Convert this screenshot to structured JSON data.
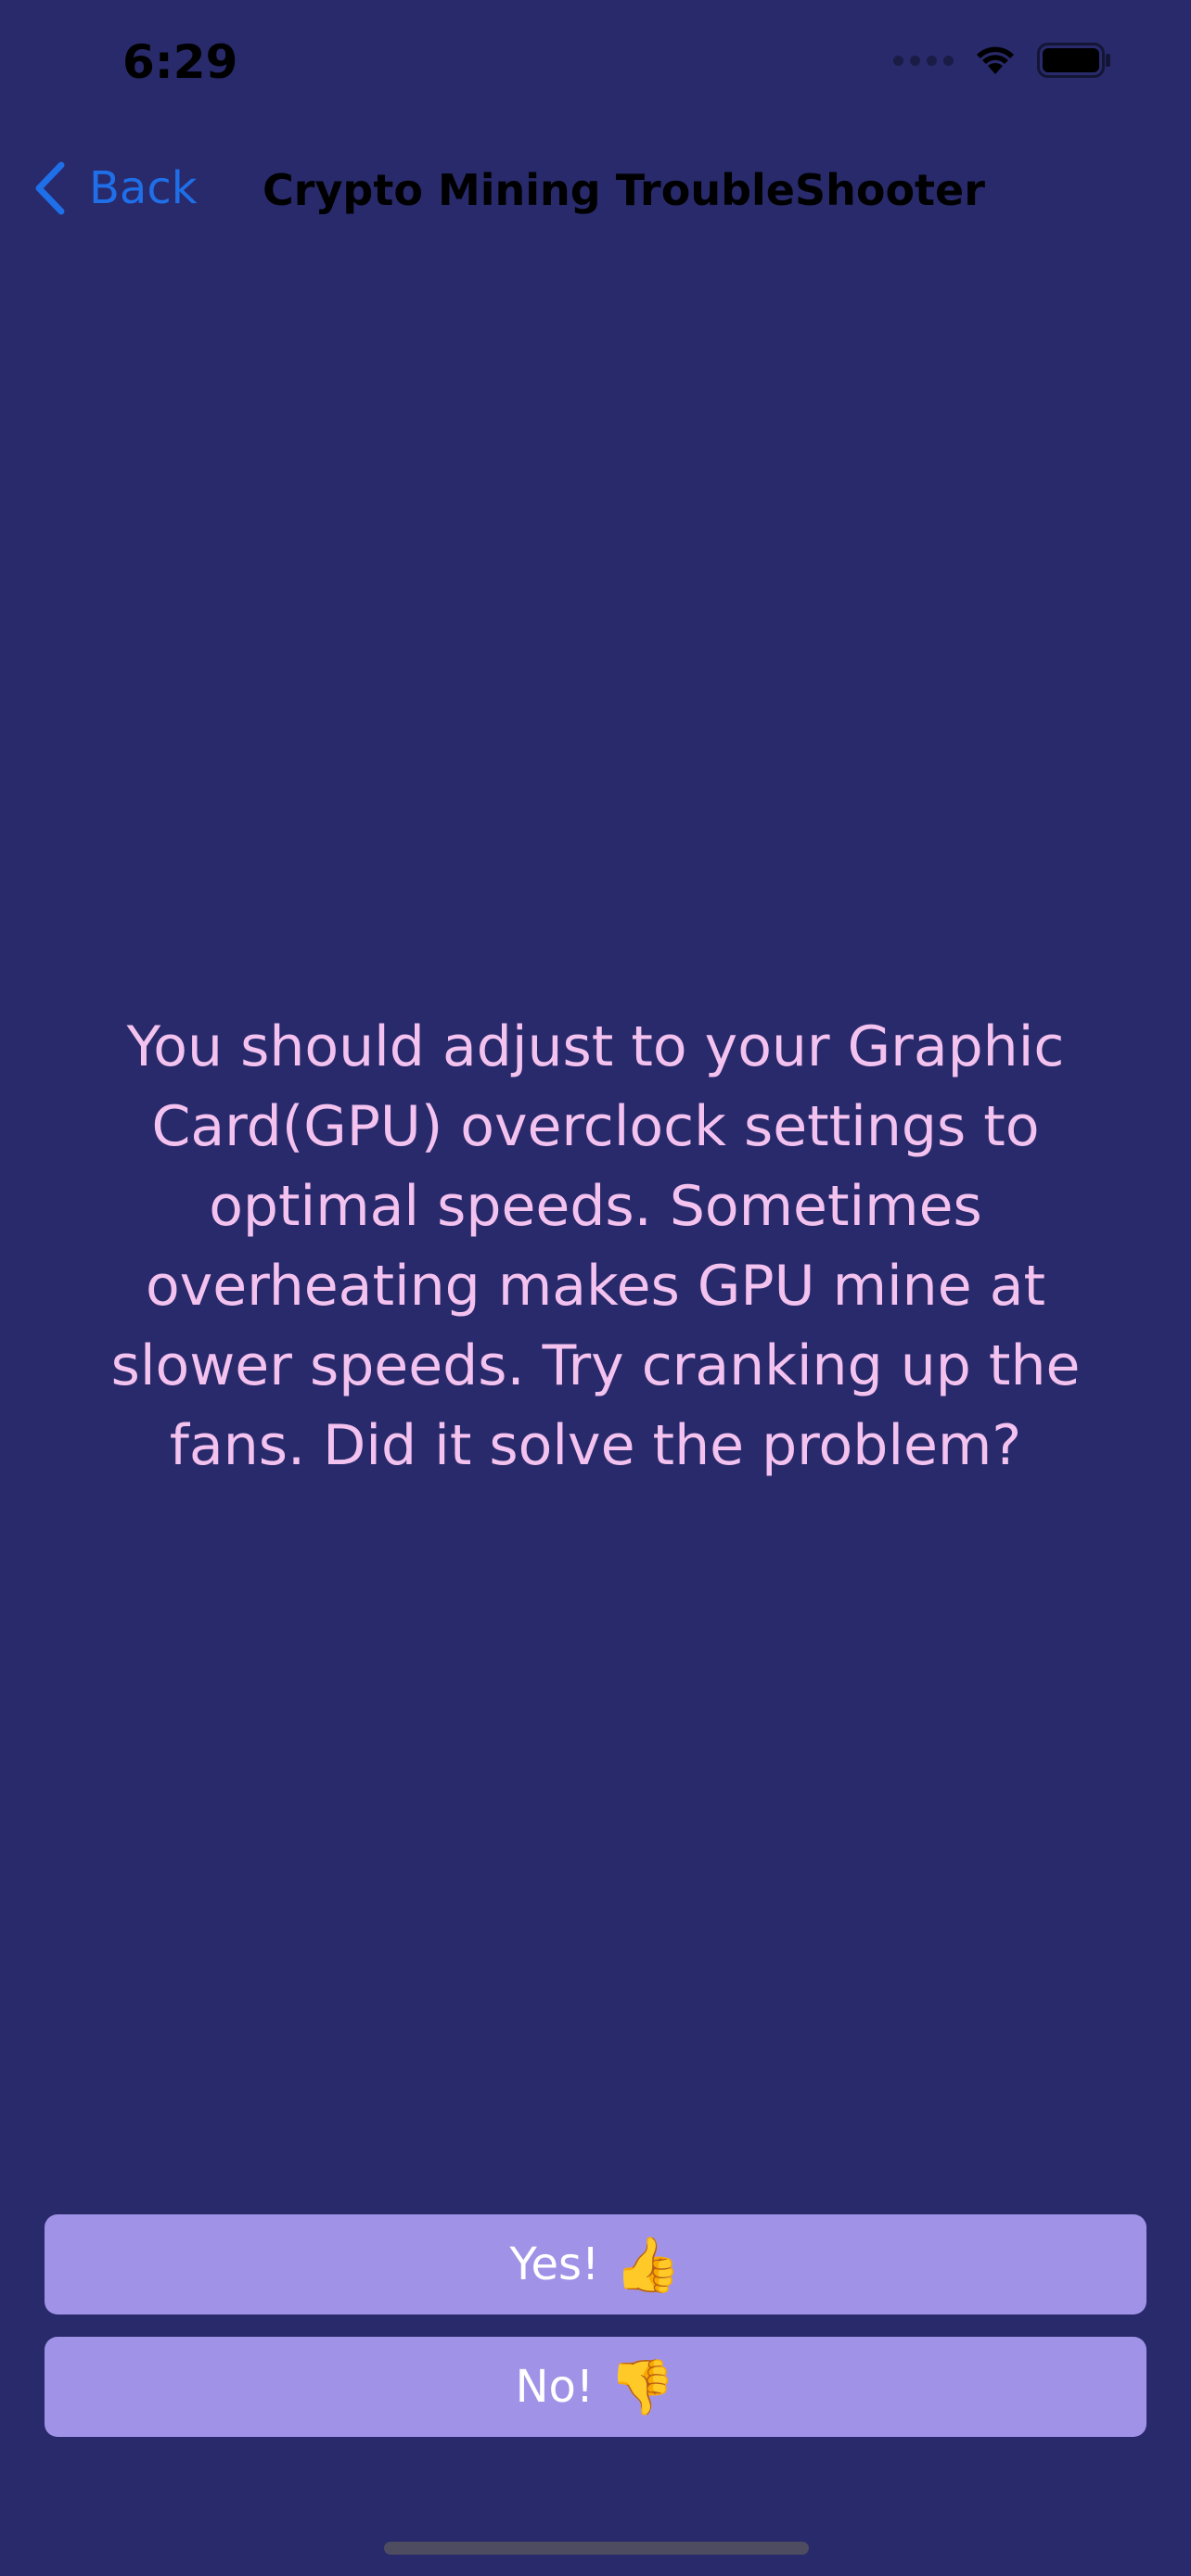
{
  "status_bar": {
    "time": "6:29",
    "icons": [
      "cellular-signal-icon",
      "wifi-icon",
      "battery-icon"
    ]
  },
  "nav": {
    "back_label": "Back",
    "title": "Crypto Mining TroubleShooter"
  },
  "question": {
    "text": "You should adjust to your Graphic Card(GPU) overclock settings to optimal speeds. Sometimes overheating makes GPU mine at slower speeds. Try cranking up the fans. Did it solve the problem?"
  },
  "answers": {
    "yes_label": "Yes!",
    "yes_emoji": "👍",
    "no_label": "No!",
    "no_emoji": "👎"
  },
  "colors": {
    "background": "#282a6b",
    "question_text": "#f4c2ef",
    "button_fill": "#a093e7",
    "button_text": "#ffffff",
    "back_link": "#1f6fe9"
  }
}
